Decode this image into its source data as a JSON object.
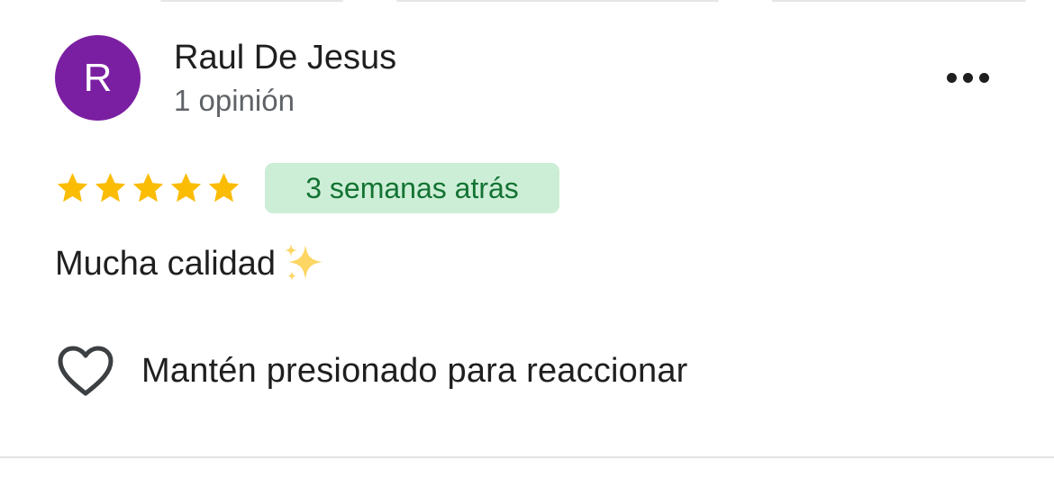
{
  "reviewer": {
    "avatar_initial": "R",
    "avatar_color": "#7b1fa2",
    "name": "Raul De Jesus",
    "review_count": "1 opinión"
  },
  "rating": {
    "stars": 5,
    "max": 5,
    "star_color": "#fbbc04"
  },
  "time_badge": {
    "label": "3 semanas atrás",
    "text_color": "#137333",
    "bg_color": "#cdeed6"
  },
  "review": {
    "text": "Mucha calidad",
    "emoji": "sparkles-icon"
  },
  "react": {
    "icon": "heart-outline-icon",
    "label": "Mantén presionado para reaccionar"
  },
  "menu": {
    "icon": "more-horizontal-icon"
  }
}
